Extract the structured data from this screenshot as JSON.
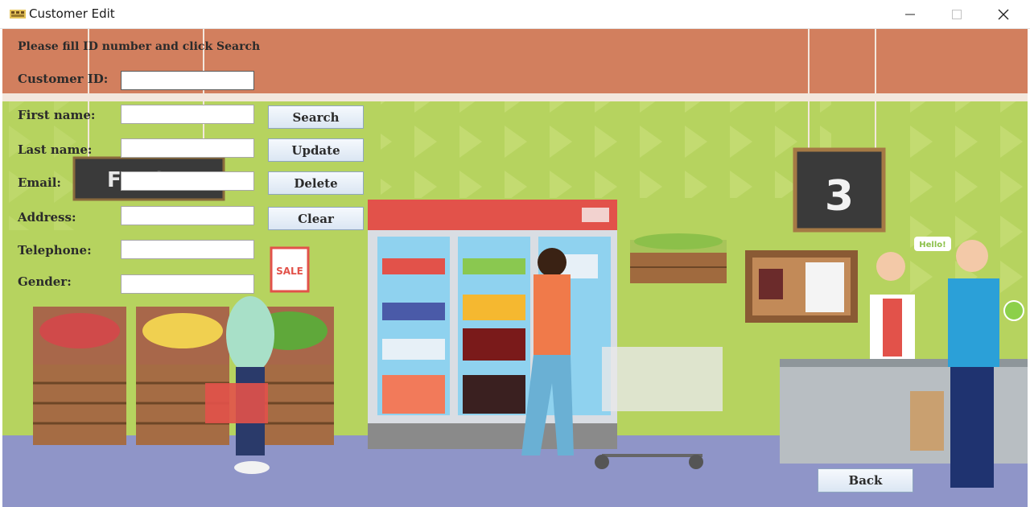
{
  "window": {
    "title": "Customer Edit",
    "icons": [
      "app-icon",
      "minimize-icon",
      "maximize-icon",
      "close-icon"
    ]
  },
  "form": {
    "instruction": "Please fill ID number and click Search",
    "labels": {
      "customer_id": "Customer ID:",
      "first_name": "First name:",
      "last_name": "Last name:",
      "email": "Email:",
      "address": "Address:",
      "telephone": "Telephone:",
      "gender": "Gender:"
    },
    "values": {
      "customer_id": "",
      "first_name": "",
      "last_name": "",
      "email": "",
      "address": "",
      "telephone": "",
      "gender": ""
    }
  },
  "buttons": {
    "search": "Search",
    "update": "Update",
    "delete": "Delete",
    "clear": "Clear",
    "back": "Back"
  },
  "background": {
    "fresh_sign": "FRESH",
    "aisle_sign": "3",
    "sale_sign": "SALE",
    "speech_bubble": "Hello!",
    "colors": {
      "header_band": "#d27f5e",
      "wall": "#b6d35f",
      "floor": "#8f95c8"
    }
  }
}
